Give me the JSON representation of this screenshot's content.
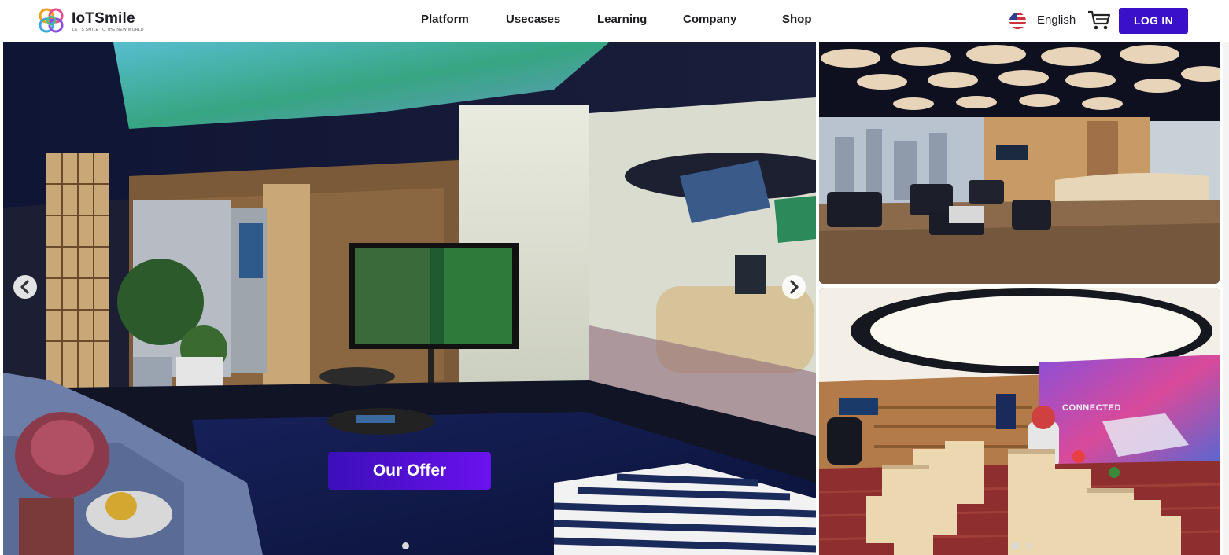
{
  "brand": {
    "name": "IoTSmile",
    "tagline": "LET'S SMILE TO THE NEW WORLD"
  },
  "nav": {
    "items": [
      {
        "label": "Platform"
      },
      {
        "label": "Usecases"
      },
      {
        "label": "Learning"
      },
      {
        "label": "Company"
      },
      {
        "label": "Shop"
      }
    ]
  },
  "header": {
    "language": "English",
    "flag_icon": "us-flag-icon",
    "cart_icon": "cart-icon",
    "login_label": "LOG IN"
  },
  "hero": {
    "cta_label": "Our Offer",
    "image_subject": "Members lounge showroom",
    "active_slide": 1
  },
  "side_panels": {
    "bottom_wall_text": "CONNECTED"
  },
  "colors": {
    "primary": "#3a10c9",
    "cta_gradient_start": "#3b0fb8",
    "cta_gradient_end": "#6a12ee",
    "text": "#1e1e22"
  }
}
